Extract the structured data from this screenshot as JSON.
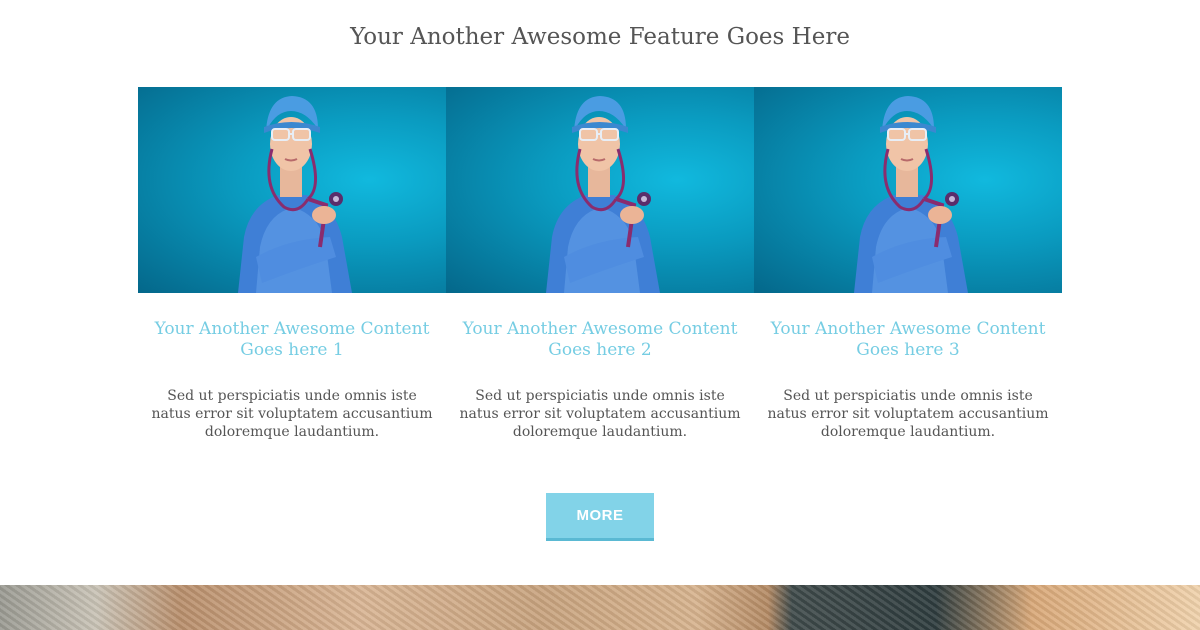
{
  "section": {
    "title": "Your Another Awesome Feature Goes Here"
  },
  "cards": [
    {
      "title": "Your Another Awesome Content Goes here 1",
      "text": "Sed ut perspiciatis unde omnis iste natus error sit voluptatem accusantium doloremque laudantium."
    },
    {
      "title": "Your Another Awesome Content Goes here 2",
      "text": "Sed ut perspiciatis unde omnis iste natus error sit voluptatem accusantium doloremque laudantium."
    },
    {
      "title": "Your Another Awesome Content Goes here 3",
      "text": "Sed ut perspiciatis unde omnis iste natus error sit voluptatem accusantium doloremque laudantium."
    }
  ],
  "more_button": {
    "label": "MORE"
  },
  "colors": {
    "accent": "#82d3e8",
    "title_accent": "#76cde3",
    "photo_bg": "#0a9bc0"
  }
}
